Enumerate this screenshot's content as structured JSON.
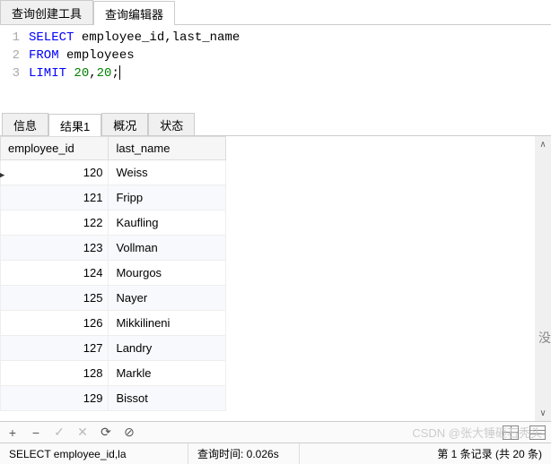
{
  "top_tabs": {
    "builder": "查询创建工具",
    "editor": "查询编辑器"
  },
  "sql": {
    "lines": [
      {
        "n": "1",
        "tokens": [
          {
            "t": "SELECT",
            "c": "kw"
          },
          {
            "t": " employee_id,last_name",
            "c": "plain"
          }
        ]
      },
      {
        "n": "2",
        "tokens": [
          {
            "t": "FROM",
            "c": "kw"
          },
          {
            "t": " employees",
            "c": "plain"
          }
        ]
      },
      {
        "n": "3",
        "tokens": [
          {
            "t": "LIMIT",
            "c": "kw"
          },
          {
            "t": " ",
            "c": "plain"
          },
          {
            "t": "20",
            "c": "num"
          },
          {
            "t": ",",
            "c": "plain"
          },
          {
            "t": "20",
            "c": "num"
          },
          {
            "t": ";",
            "c": "plain"
          }
        ]
      }
    ]
  },
  "result_tabs": {
    "info": "信息",
    "result1": "结果1",
    "profile": "概况",
    "status": "状态"
  },
  "columns": {
    "id": "employee_id",
    "name": "last_name"
  },
  "rows": [
    {
      "id": "120",
      "name": "Weiss"
    },
    {
      "id": "121",
      "name": "Fripp"
    },
    {
      "id": "122",
      "name": "Kaufling"
    },
    {
      "id": "123",
      "name": "Vollman"
    },
    {
      "id": "124",
      "name": "Mourgos"
    },
    {
      "id": "125",
      "name": "Nayer"
    },
    {
      "id": "126",
      "name": "Mikkilineni"
    },
    {
      "id": "127",
      "name": "Landry"
    },
    {
      "id": "128",
      "name": "Markle"
    },
    {
      "id": "129",
      "name": "Bissot"
    }
  ],
  "right_clip": "没",
  "toolbar": {
    "add": "+",
    "del": "−",
    "apply": "✓",
    "cancel": "✕",
    "refresh": "⟳",
    "stop": "⊘"
  },
  "status": {
    "sql": "SELECT employee_id,la",
    "time": "查询时间: 0.026s",
    "pos": "第 1 条记录 (共 20 条)"
  },
  "watermark": "CSDN @张大锤砸石秃头"
}
